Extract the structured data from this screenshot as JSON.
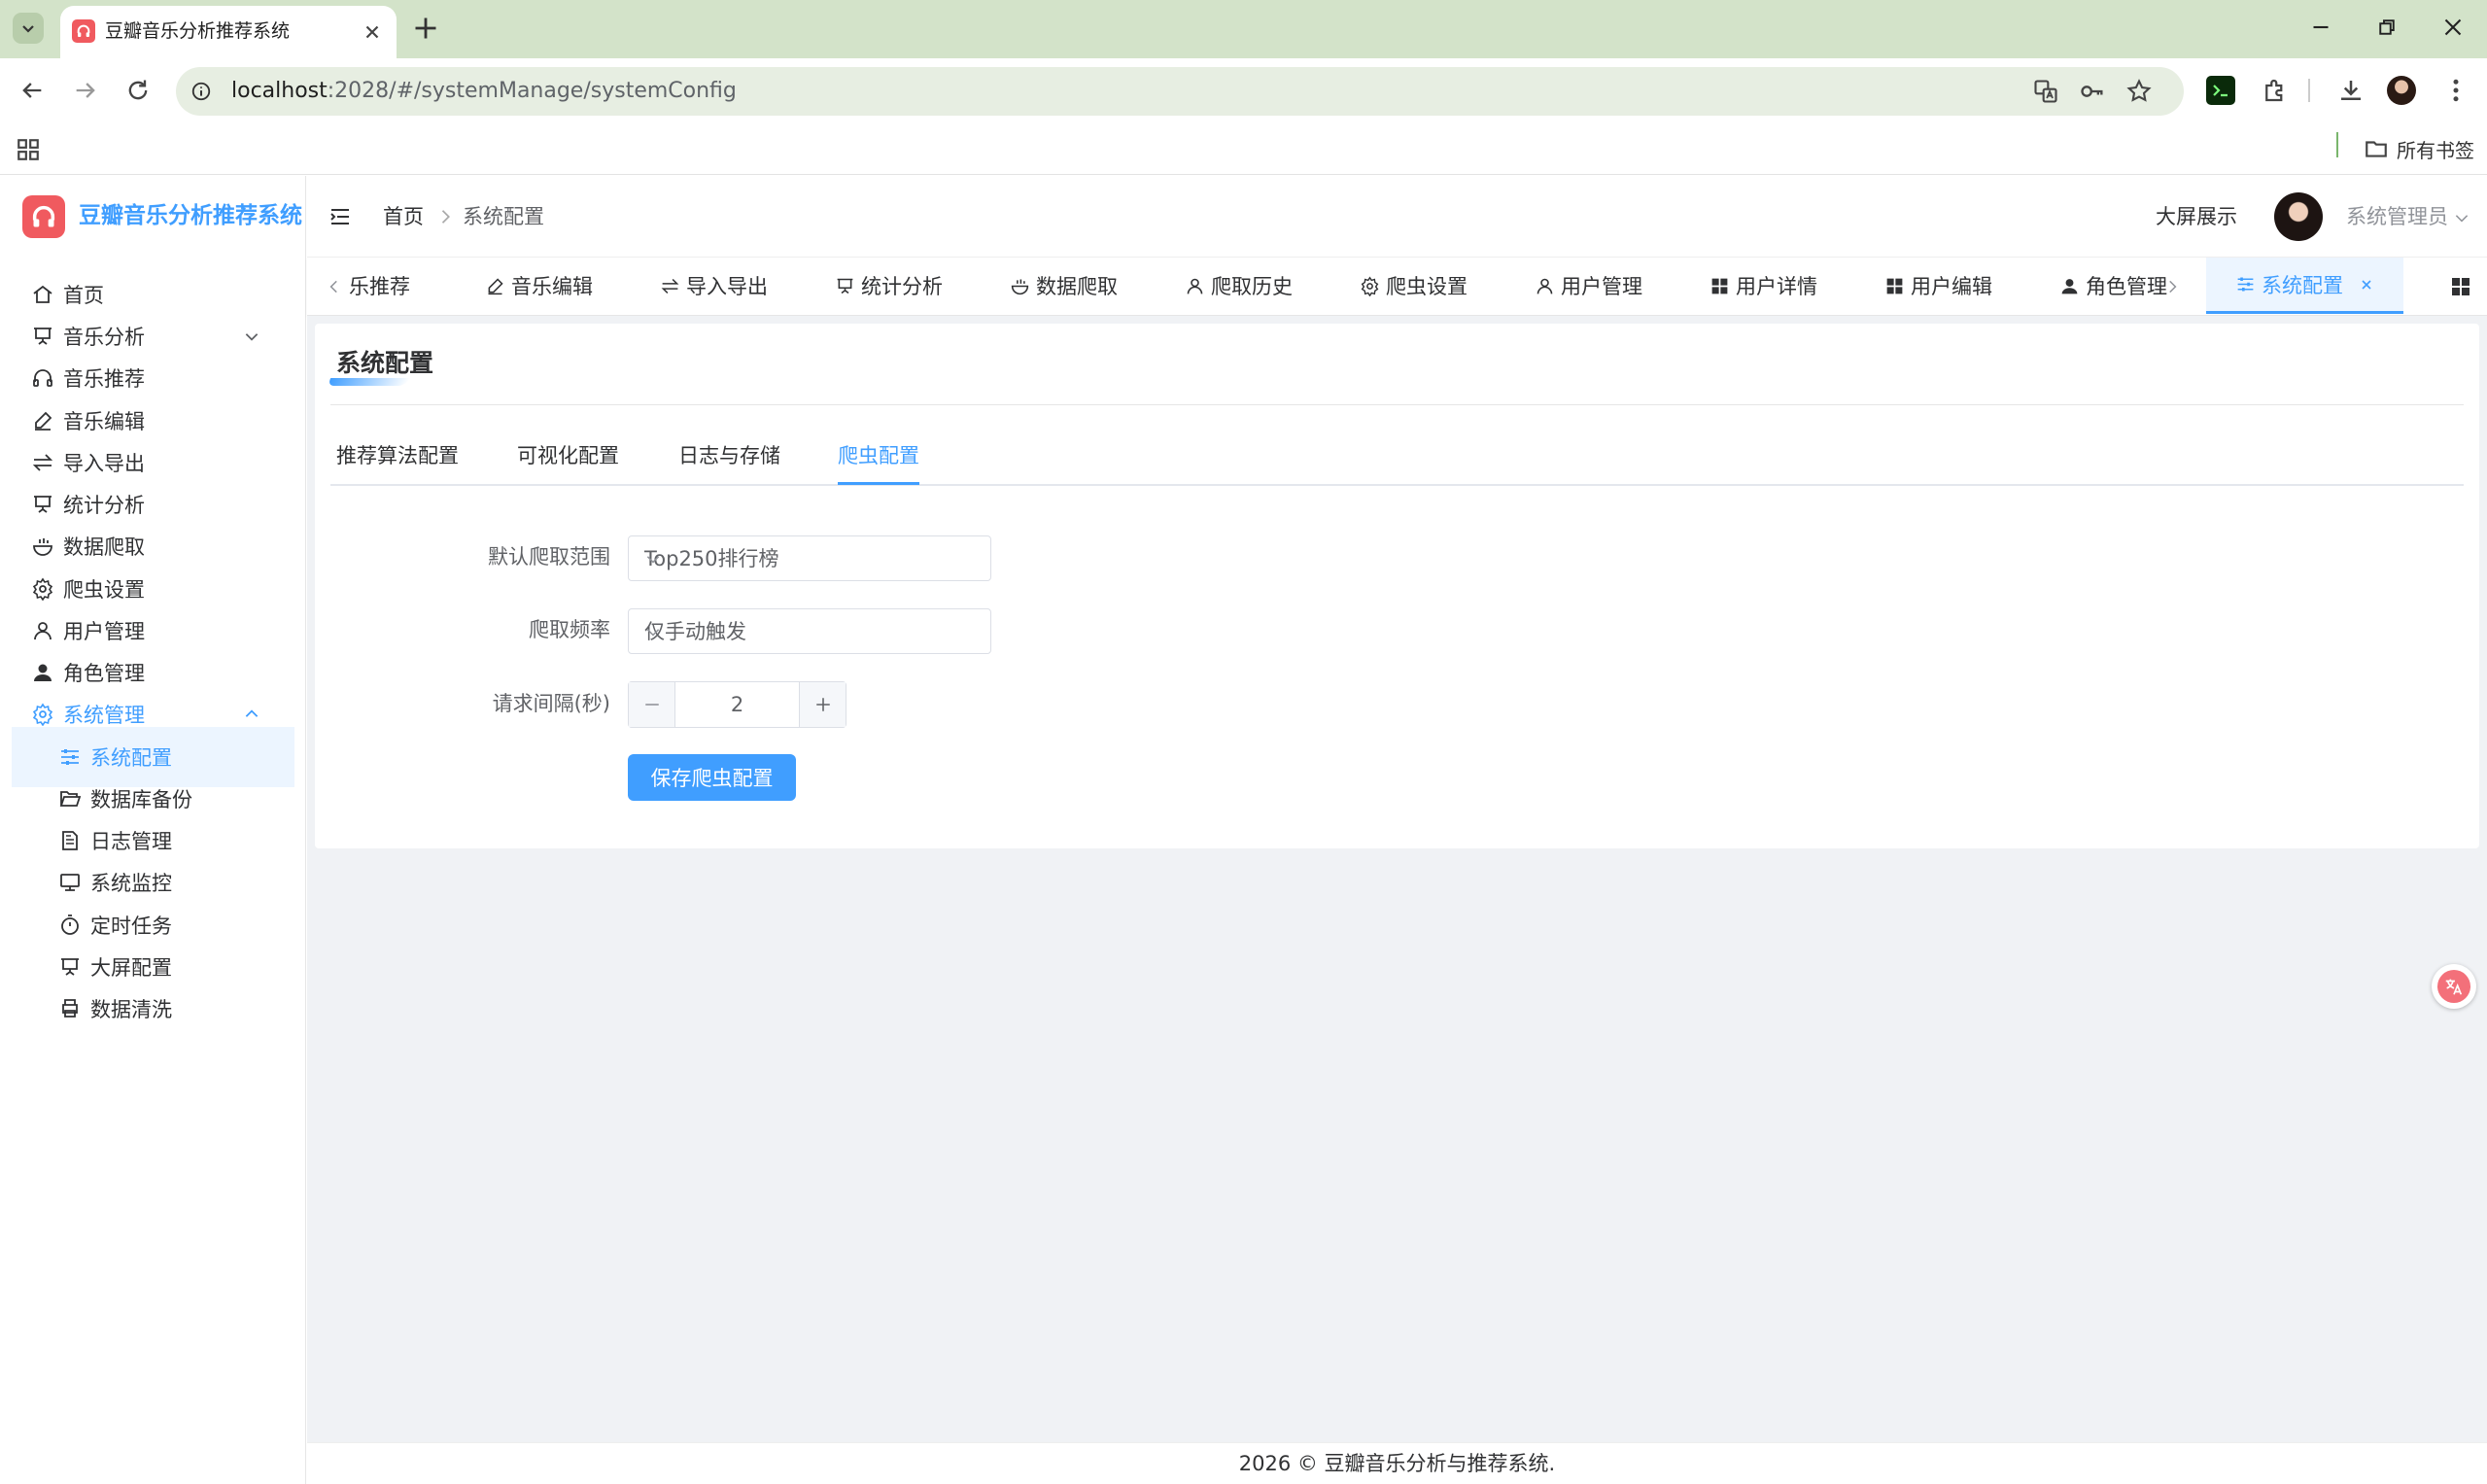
{
  "browser": {
    "tab_title": "豆瓣音乐分析推荐系统",
    "url_host": "localhost",
    "url_rest": ":2028/#/systemManage/systemConfig",
    "bookmarks_all": "所有书签"
  },
  "app": {
    "title": "豆瓣音乐分析推荐系统",
    "brand_color": "#409eff"
  },
  "sidebar": {
    "items": [
      {
        "label": "首页"
      },
      {
        "label": "音乐分析"
      },
      {
        "label": "音乐推荐"
      },
      {
        "label": "音乐编辑"
      },
      {
        "label": "导入导出"
      },
      {
        "label": "统计分析"
      },
      {
        "label": "数据爬取"
      },
      {
        "label": "爬虫设置"
      },
      {
        "label": "用户管理"
      },
      {
        "label": "角色管理"
      },
      {
        "label": "系统管理"
      },
      {
        "label": "系统配置"
      },
      {
        "label": "数据库备份"
      },
      {
        "label": "日志管理"
      },
      {
        "label": "系统监控"
      },
      {
        "label": "定时任务"
      },
      {
        "label": "大屏配置"
      },
      {
        "label": "数据清洗"
      }
    ]
  },
  "header": {
    "breadcrumb_home": "首页",
    "breadcrumb_current": "系统配置",
    "bigscreen": "大屏展示",
    "user": "系统管理员"
  },
  "view_tabs": [
    {
      "label": "乐推荐"
    },
    {
      "label": "音乐编辑"
    },
    {
      "label": "导入导出"
    },
    {
      "label": "统计分析"
    },
    {
      "label": "数据爬取"
    },
    {
      "label": "爬取历史"
    },
    {
      "label": "爬虫设置"
    },
    {
      "label": "用户管理"
    },
    {
      "label": "用户详情"
    },
    {
      "label": "用户编辑"
    },
    {
      "label": "角色管理"
    },
    {
      "label": "系统配置"
    }
  ],
  "page": {
    "title": "系统配置",
    "tabs": [
      {
        "label": "推荐算法配置"
      },
      {
        "label": "可视化配置"
      },
      {
        "label": "日志与存储"
      },
      {
        "label": "爬虫配置"
      }
    ],
    "form": {
      "scope_label": "默认爬取范围",
      "scope_value": "Top250排行榜",
      "freq_label": "爬取频率",
      "freq_value": "仅手动触发",
      "interval_label": "请求间隔(秒)",
      "interval_value": "2",
      "save_label": "保存爬虫配置"
    }
  },
  "footer": "2026 © 豆瓣音乐分析与推荐系统."
}
